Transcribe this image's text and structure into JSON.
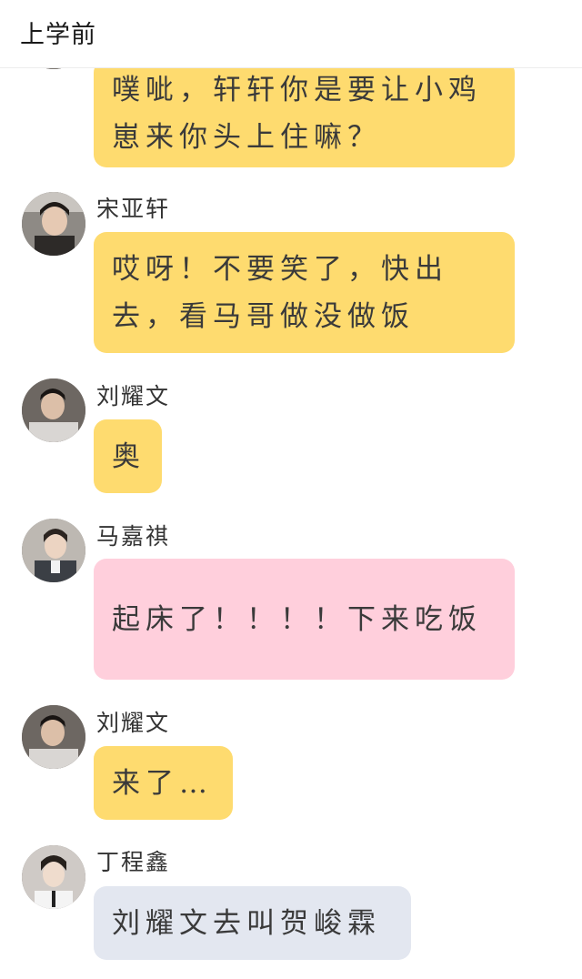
{
  "header": {
    "title": "上学前"
  },
  "colors": {
    "yellow_bubble": "#fedb6f",
    "pink_bubble": "#ffcfdc",
    "gray_bubble": "#e3e7f0"
  },
  "messages": [
    {
      "sender": "",
      "text": "噗呲，轩轩你是要让小鸡崽来你头上住嘛？",
      "color": "yellow",
      "avatar": "avatar-partial"
    },
    {
      "sender": "宋亚轩",
      "text": "哎呀！不要笑了，快出去，看马哥做没做饭",
      "color": "yellow",
      "avatar": "avatar-songyaxuan"
    },
    {
      "sender": "刘耀文",
      "text": "奥",
      "color": "yellow",
      "avatar": "avatar-liuyaowen"
    },
    {
      "sender": "马嘉祺",
      "text": "起床了！！！！下来吃饭",
      "color": "pink",
      "avatar": "avatar-majiaqi"
    },
    {
      "sender": "刘耀文",
      "text": "来了…",
      "color": "yellow",
      "avatar": "avatar-liuyaowen"
    },
    {
      "sender": "丁程鑫",
      "text": "刘耀文去叫贺峻霖",
      "color": "gray",
      "avatar": "avatar-dingchengxin"
    }
  ]
}
